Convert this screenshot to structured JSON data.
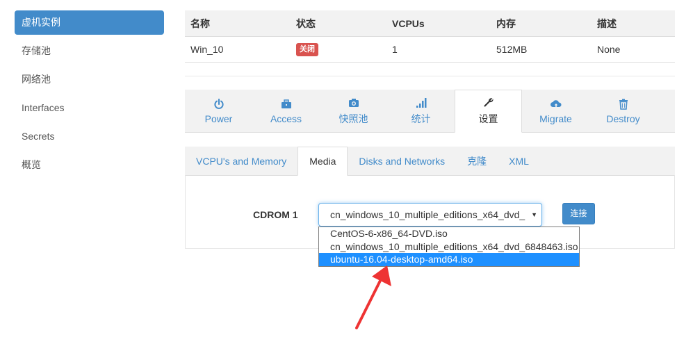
{
  "sidebar": {
    "items": [
      {
        "label": "虚机实例",
        "active": true
      },
      {
        "label": "存储池",
        "active": false
      },
      {
        "label": "网络池",
        "active": false
      },
      {
        "label": "Interfaces",
        "active": false
      },
      {
        "label": "Secrets",
        "active": false
      },
      {
        "label": "概览",
        "active": false
      }
    ]
  },
  "vm_table": {
    "headers": [
      "名称",
      "状态",
      "VCPUs",
      "内存",
      "描述"
    ],
    "row": {
      "name": "Win_10",
      "status": "关闭",
      "vcpus": "1",
      "memory": "512MB",
      "description": "None"
    }
  },
  "action_tabs": [
    {
      "label": "Power",
      "icon": "power-icon",
      "active": false
    },
    {
      "label": "Access",
      "icon": "briefcase-icon",
      "active": false
    },
    {
      "label": "快照池",
      "icon": "camera-icon",
      "active": false
    },
    {
      "label": "统计",
      "icon": "signal-bars-icon",
      "active": false
    },
    {
      "label": "设置",
      "icon": "wrench-icon",
      "active": true
    },
    {
      "label": "Migrate",
      "icon": "cloud-upload-icon",
      "active": false
    },
    {
      "label": "Destroy",
      "icon": "trash-icon",
      "active": false
    }
  ],
  "sub_tabs": [
    {
      "label": "VCPU's and Memory",
      "active": false
    },
    {
      "label": "Media",
      "active": true
    },
    {
      "label": "Disks and Networks",
      "active": false
    },
    {
      "label": "克隆",
      "active": false
    },
    {
      "label": "XML",
      "active": false
    }
  ],
  "media": {
    "cdrom_label": "CDROM 1",
    "selected_value": "cn_windows_10_multiple_editions_x64_dvd_",
    "connect_label": "连接",
    "options": [
      {
        "label": "CentOS-6-x86_64-DVD.iso",
        "highlighted": false
      },
      {
        "label": "cn_windows_10_multiple_editions_x64_dvd_6848463.iso",
        "highlighted": false
      },
      {
        "label": "ubuntu-16.04-desktop-amd64.iso",
        "highlighted": true
      }
    ]
  },
  "colors": {
    "primary": "#428bca",
    "danger": "#d9534f",
    "highlight": "#1e90ff",
    "annotation_arrow": "#ee3333"
  }
}
